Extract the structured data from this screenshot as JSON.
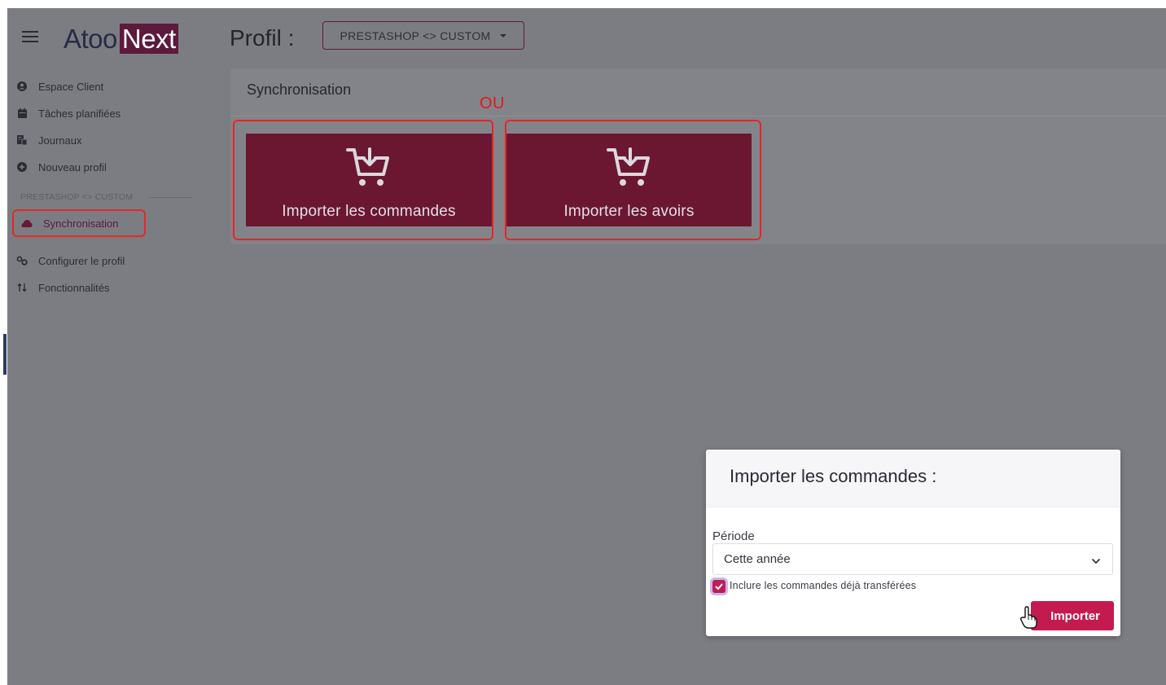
{
  "app": {
    "logo_part1": "Atoo",
    "logo_part2": "Next",
    "profile_label": "Profil :",
    "profile_value": "PRESTASHOP <> CUSTOM"
  },
  "sidebar": {
    "items": [
      {
        "label": "Espace Client",
        "icon": "user-circle-icon"
      },
      {
        "label": "Tâches planifiées",
        "icon": "calendar-icon"
      },
      {
        "label": "Journaux",
        "icon": "file-list-icon"
      },
      {
        "label": "Nouveau profil",
        "icon": "plus-circle-icon"
      }
    ],
    "section_label": "PRESTASHOP <> CUSTOM",
    "profile_items": [
      {
        "label": "Synchronisation",
        "icon": "cloud-icon",
        "active": true
      },
      {
        "label": "Configurer le profil",
        "icon": "gears-icon"
      },
      {
        "label": "Fonctionnalités",
        "icon": "sort-arrows-icon"
      }
    ]
  },
  "main": {
    "card_title": "Synchronisation",
    "or_annotation": "OU",
    "tiles": [
      {
        "label": "Importer les commandes",
        "icon": "cart-download-icon"
      },
      {
        "label": "Importer les avoirs",
        "icon": "cart-download-icon"
      }
    ]
  },
  "modal": {
    "title": "Importer les commandes :",
    "period_label": "Période",
    "period_value": "Cette année",
    "include_checkbox_label": "Inclure les commandes déjà transférées",
    "include_checked": true,
    "import_button": "Importer"
  },
  "colors": {
    "brand": "#5c1a3d",
    "tile": "#6b1732",
    "accent_button": "#c51a4f",
    "annotation_red": "#e12727"
  }
}
